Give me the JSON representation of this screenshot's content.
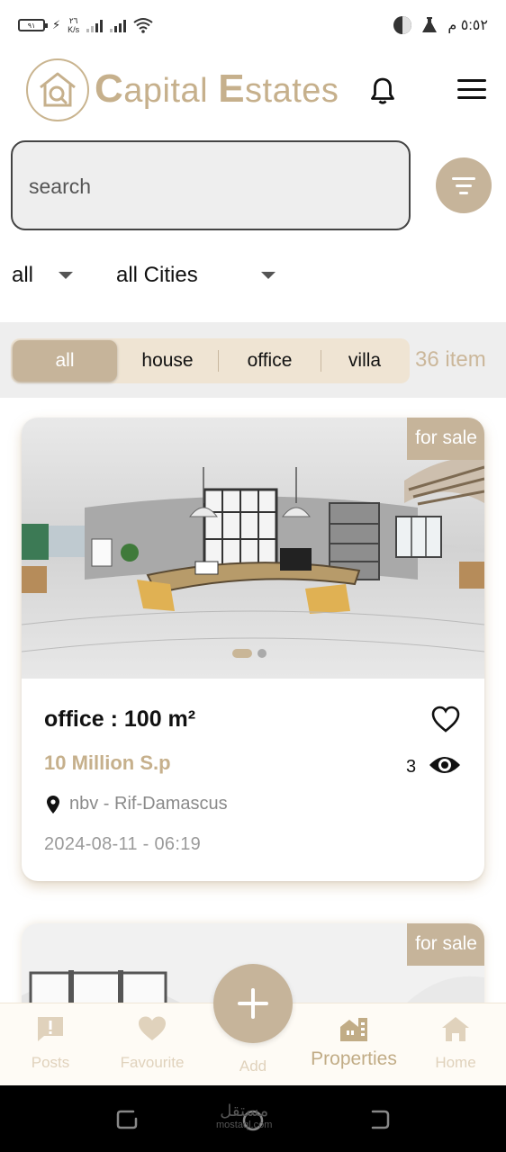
{
  "status_bar": {
    "battery": "٩١",
    "net_speed_top": "٢٦",
    "net_speed_unit": "K/s",
    "time": "٥:٥٢ م"
  },
  "header": {
    "brand_first": "C",
    "brand_rest_1": "apital ",
    "brand_second": "E",
    "brand_rest_2": "states"
  },
  "search": {
    "placeholder": "search"
  },
  "filters": {
    "type_selected": "all",
    "city_selected": "all Cities"
  },
  "categories": {
    "tabs": [
      {
        "label": "all",
        "active": true
      },
      {
        "label": "house",
        "active": false
      },
      {
        "label": "office",
        "active": false
      },
      {
        "label": "villa",
        "active": false
      }
    ],
    "item_count": "36 item"
  },
  "listings": [
    {
      "badge": "for sale",
      "title": "office : 100 m²",
      "price": "10 Million S.p",
      "views": "3",
      "location": "nbv - Rif-Damascus",
      "date": "2024-08-11 - 06:19",
      "image_slide_count": 2,
      "image_slide_current": 1
    },
    {
      "badge": "for sale"
    }
  ],
  "bottom_nav": {
    "items": [
      {
        "label": "Posts",
        "icon": "alert-message-icon"
      },
      {
        "label": "Favourite",
        "icon": "heart-icon"
      },
      {
        "label": "Add",
        "icon": "plus-icon"
      },
      {
        "label": "Properties",
        "icon": "buildings-icon",
        "active": true
      },
      {
        "label": "Home",
        "icon": "home-icon"
      }
    ]
  },
  "system_nav": {
    "watermark_ar": "مستقل",
    "watermark_en": "mostaql.com"
  },
  "colors": {
    "accent": "#c6b49a",
    "accent_text": "#c6b08c",
    "segment_bg": "#efe4d3",
    "band_bg": "#eeeeee"
  }
}
